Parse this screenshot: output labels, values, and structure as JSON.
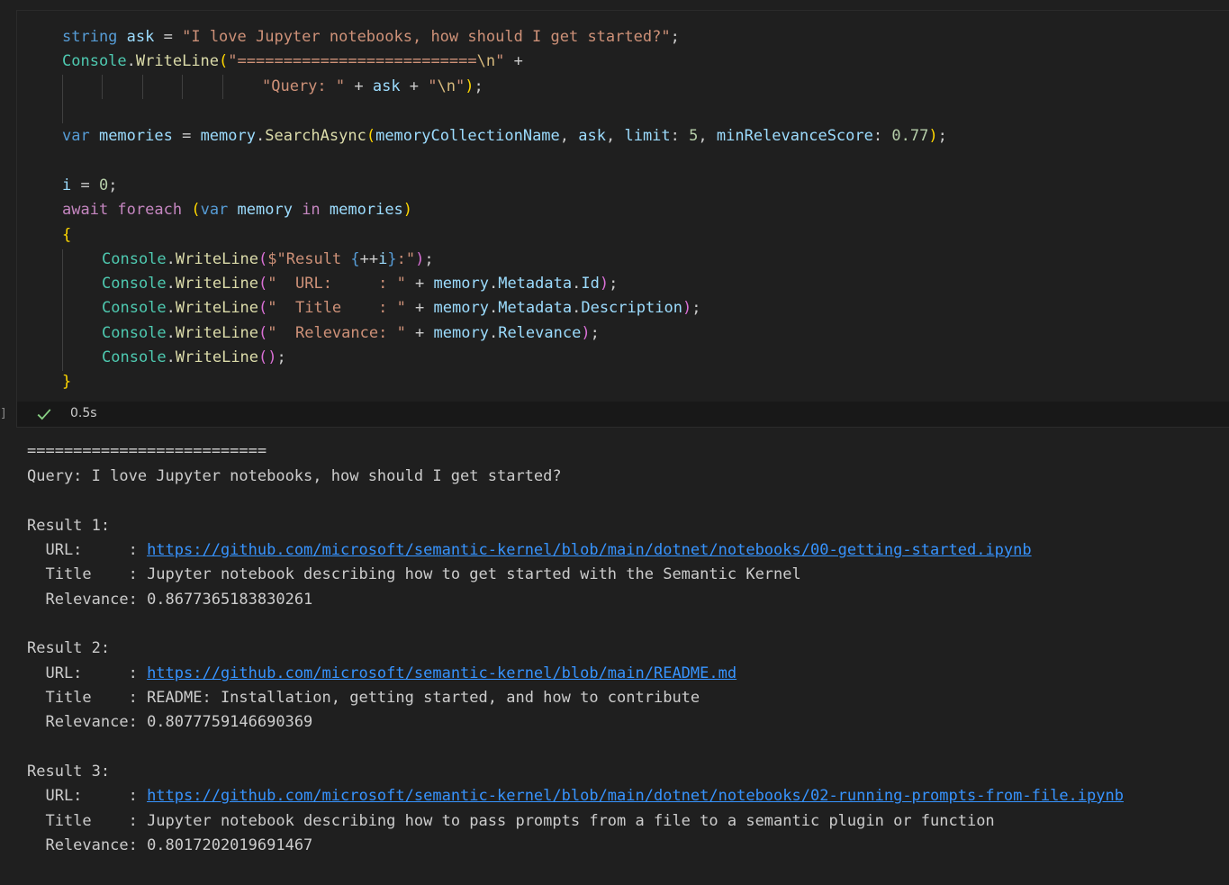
{
  "code": {
    "line1": {
      "type": "string",
      "name": "ask",
      "op": " = ",
      "value": "\"I love Jupyter notebooks, how should I get started?\"",
      "end": ";"
    },
    "line2": {
      "obj": "Console",
      "dot": ".",
      "method": "WriteLine",
      "paren": "(",
      "str": "\"==========================",
      "esc": "\\n",
      "strend": "\"",
      "plus": " +"
    },
    "line3": {
      "str1": "\"Query: \"",
      "plus1": " + ",
      "var": "ask",
      "plus2": " + ",
      "str2a": "\"",
      "esc": "\\n",
      "str2b": "\"",
      "paren": ")",
      "end": ";"
    },
    "line5": {
      "kw": "var",
      "name": " memories",
      "op": " = ",
      "obj": "memory",
      "dot": ".",
      "method": "SearchAsync",
      "paren": "(",
      "arg1": "memoryCollectionName",
      "c1": ", ",
      "arg2": "ask",
      "c2": ", ",
      "label1": "limit",
      "colon1": ": ",
      "num1": "5",
      "c3": ", ",
      "label2": "minRelevanceScore",
      "colon2": ": ",
      "num2": "0.77",
      "paren2": ")",
      "end": ";"
    },
    "line7": {
      "var": "i",
      "op": " = ",
      "num": "0",
      "end": ";"
    },
    "line8": {
      "kw1": "await",
      "kw2": " foreach",
      "sp": " ",
      "paren": "(",
      "kw3": "var",
      "var1": " memory",
      "kw4": " in",
      "var2": " memories",
      "paren2": ")"
    },
    "line9": {
      "brace": "{"
    },
    "line10": {
      "obj": "Console",
      "dot": ".",
      "method": "WriteLine",
      "paren": "(",
      "str1": "$\"Result ",
      "b1": "{",
      "inc": "++",
      "var": "i",
      "b2": "}",
      "str2": ":\"",
      "paren2": ")",
      "end": ";"
    },
    "line11": {
      "obj": "Console",
      "dot": ".",
      "method": "WriteLine",
      "paren": "(",
      "str": "\"  URL:     : \"",
      "plus": " + ",
      "v1": "memory",
      "d1": ".",
      "v2": "Metadata",
      "d2": ".",
      "v3": "Id",
      "paren2": ")",
      "end": ";"
    },
    "line12": {
      "obj": "Console",
      "dot": ".",
      "method": "WriteLine",
      "paren": "(",
      "str": "\"  Title    : \"",
      "plus": " + ",
      "v1": "memory",
      "d1": ".",
      "v2": "Metadata",
      "d2": ".",
      "v3": "Description",
      "paren2": ")",
      "end": ";"
    },
    "line13": {
      "obj": "Console",
      "dot": ".",
      "method": "WriteLine",
      "paren": "(",
      "str": "\"  Relevance: \"",
      "plus": " + ",
      "v1": "memory",
      "d1": ".",
      "v2": "Relevance",
      "paren2": ")",
      "end": ";"
    },
    "line14": {
      "obj": "Console",
      "dot": ".",
      "method": "WriteLine",
      "paren": "()",
      "end": ";"
    },
    "line15": {
      "brace": "}"
    }
  },
  "status": {
    "bracket": "]",
    "time": "0.5s",
    "icon": "check-icon"
  },
  "output": {
    "separator": "==========================",
    "query": "Query: I love Jupyter notebooks, how should I get started?",
    "results": [
      {
        "header": "Result 1:",
        "url_label": "  URL:     : ",
        "url": "https://github.com/microsoft/semantic-kernel/blob/main/dotnet/notebooks/00-getting-started.ipynb",
        "title_label": "  Title    : ",
        "title": "Jupyter notebook describing how to get started with the Semantic Kernel",
        "rel_label": "  Relevance: ",
        "relevance": "0.8677365183830261"
      },
      {
        "header": "Result 2:",
        "url_label": "  URL:     : ",
        "url": "https://github.com/microsoft/semantic-kernel/blob/main/README.md",
        "title_label": "  Title    : ",
        "title": "README: Installation, getting started, and how to contribute",
        "rel_label": "  Relevance: ",
        "relevance": "0.8077759146690369"
      },
      {
        "header": "Result 3:",
        "url_label": "  URL:     : ",
        "url": "https://github.com/microsoft/semantic-kernel/blob/main/dotnet/notebooks/02-running-prompts-from-file.ipynb",
        "title_label": "  Title    : ",
        "title": "Jupyter notebook describing how to pass prompts from a file to a semantic plugin or function",
        "rel_label": "  Relevance: ",
        "relevance": "0.8017202019691467"
      }
    ]
  },
  "colors": {
    "background": "#1f1f1f",
    "keyword": "#569cd6",
    "type": "#4ec9b0",
    "function": "#dcdcaa",
    "variable": "#9cdcfe",
    "string": "#ce9178",
    "number": "#b5cea8",
    "link": "#3794ff",
    "success": "#89d185"
  }
}
